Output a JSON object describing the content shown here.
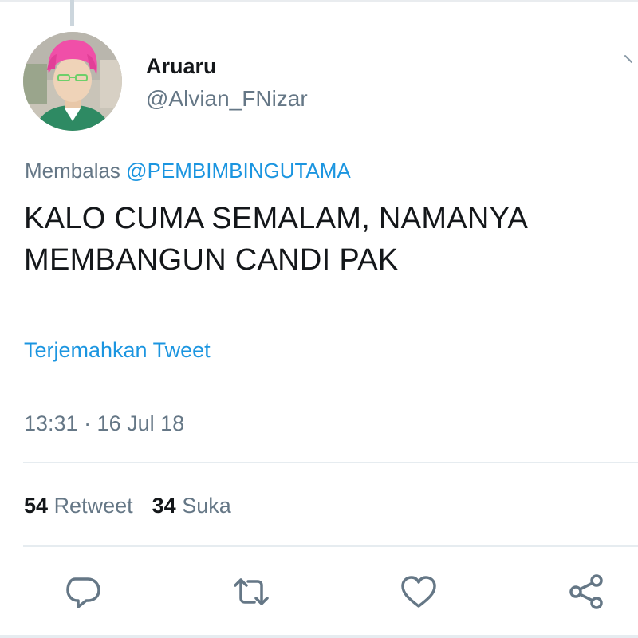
{
  "tweet": {
    "author_name": "Aruaru",
    "author_handle": "@Alvian_FNizar",
    "reply_prefix": "Membalas",
    "reply_mention": "@PEMBIMBINGUTAMA",
    "text_lines": [
      "KALO CUMA SEMALAM, NAMANYA",
      "MEMBANGUN CANDI PAK"
    ],
    "translate_label": "Terjemahkan Tweet",
    "timestamp": "13:31 · 16 Jul 18"
  },
  "stats": {
    "retweet_count": "54",
    "retweet_label": "Retweet",
    "like_count": "34",
    "like_label": "Suka"
  },
  "actions": {
    "reply_icon": "reply-icon",
    "retweet_icon": "retweet-icon",
    "like_icon": "heart-icon",
    "share_icon": "share-icon"
  },
  "colors": {
    "link": "#1b95e0",
    "secondary_text": "#657786",
    "primary_text": "#14171a",
    "divider": "#e6ecf0"
  }
}
